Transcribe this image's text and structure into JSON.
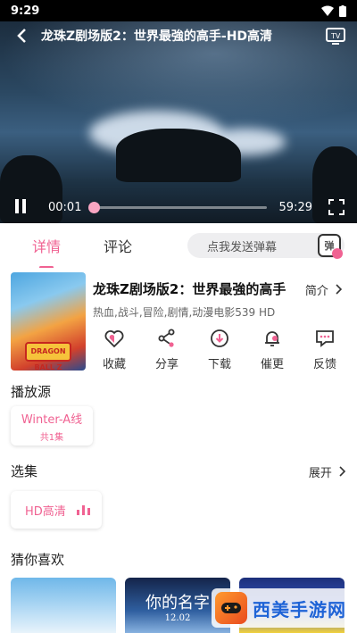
{
  "status_bar": {
    "time": "9:29"
  },
  "player": {
    "title": "龙珠Z剧场版2：世界最強的高手-HD高清",
    "current_time": "00:01",
    "duration": "59:29",
    "progress_fraction": 0.0
  },
  "tabs": {
    "details": "详情",
    "comments": "评论"
  },
  "danmaku": {
    "placeholder": "点我发送弹幕",
    "badge": "弹"
  },
  "movie": {
    "title": "龙珠Z剧场版2：世界最強的高手",
    "intro_link": "简介",
    "tags": "热血,战斗,冒险,剧情,动漫电影539 HD",
    "poster_logo": "DRAGON BALL Z"
  },
  "actions": [
    {
      "label": "收藏",
      "icon": "heart-icon"
    },
    {
      "label": "分享",
      "icon": "share-icon"
    },
    {
      "label": "下载",
      "icon": "download-icon"
    },
    {
      "label": "催更",
      "icon": "bell-icon"
    },
    {
      "label": "反馈",
      "icon": "feedback-icon"
    }
  ],
  "source_section": {
    "title": "播放源",
    "source_name": "Winter-A线",
    "episode_count": "共1集"
  },
  "episode_section": {
    "title": "选集",
    "expand_label": "展开",
    "episode_label": "HD高清"
  },
  "recommend_section": {
    "title": "猜你喜欢",
    "cards": [
      {
        "caption": ""
      },
      {
        "caption": "你的名字",
        "date": "12.02"
      },
      {
        "caption": ""
      }
    ]
  },
  "watermark": {
    "text": "西美手游网"
  },
  "colors": {
    "accent": "#f06292",
    "player_bg": "#2b4862"
  }
}
